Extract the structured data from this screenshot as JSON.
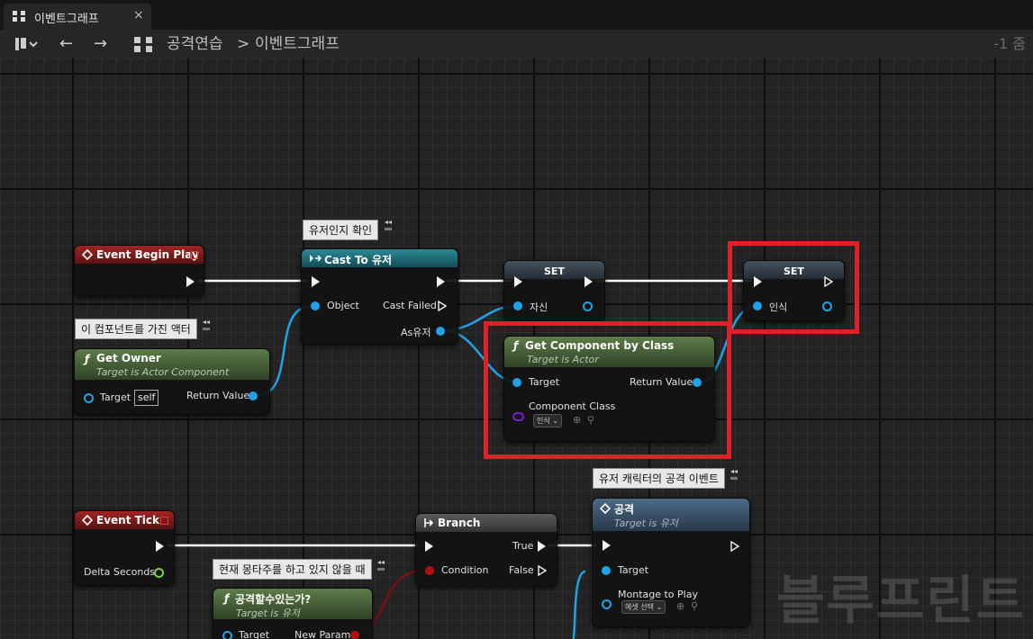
{
  "tab": {
    "title": "이벤트그래프",
    "close": "×"
  },
  "toolbar": {
    "back": "←",
    "forward": "→",
    "crumb_root": "공격연습",
    "crumb_sep": ">",
    "crumb_leaf": "이벤트그래프",
    "zoom": "-1 줌"
  },
  "comments": {
    "cast": "유저인지 확인",
    "owner": "이 컴포넌트를 가진 액터",
    "attack_event": "유저 캐릭터의 공격 이벤트",
    "can_attack": "현재 몽타주를 하고 있지 않을 때"
  },
  "nodes": {
    "begin_play": {
      "title": "Event Begin Play"
    },
    "cast": {
      "title": "Cast To 유저",
      "object": "Object",
      "cast_failed": "Cast Failed",
      "as": "As유저"
    },
    "set1": {
      "title": "SET",
      "pin": "자신"
    },
    "set2": {
      "title": "SET",
      "pin": "인식"
    },
    "get_owner": {
      "title": "Get Owner",
      "subtitle": "Target is Actor Component",
      "target": "Target",
      "self": "self",
      "return": "Return Value"
    },
    "get_component": {
      "title": "Get Component by Class",
      "subtitle": "Target is Actor",
      "target": "Target",
      "return": "Return Value",
      "class_label": "Component Class",
      "class_value": "인식"
    },
    "tick": {
      "title": "Event Tick",
      "delta": "Delta Seconds"
    },
    "branch": {
      "title": "Branch",
      "true": "True",
      "false": "False",
      "condition": "Condition"
    },
    "attack": {
      "title": "공격",
      "subtitle": "Target is 유저",
      "target": "Target",
      "montage": "Montage to Play",
      "montage_value": "에셋 선택"
    },
    "can_attack": {
      "title": "공격할수있는가?",
      "subtitle": "Target is 유저",
      "target": "Target",
      "new_param": "New Param"
    }
  },
  "watermark": "블루프린트",
  "colors": {
    "event_head": "#8a1c1c",
    "cast_head": "#1b6a74",
    "func_head": "#4e6b3d",
    "set_head": "#3a4652",
    "object_pin": "#1fa3e8",
    "float_pin": "#7ad24a",
    "bool_pin": "#b01010",
    "class_pin": "#7a1fd0",
    "highlight": "#e01f26"
  }
}
